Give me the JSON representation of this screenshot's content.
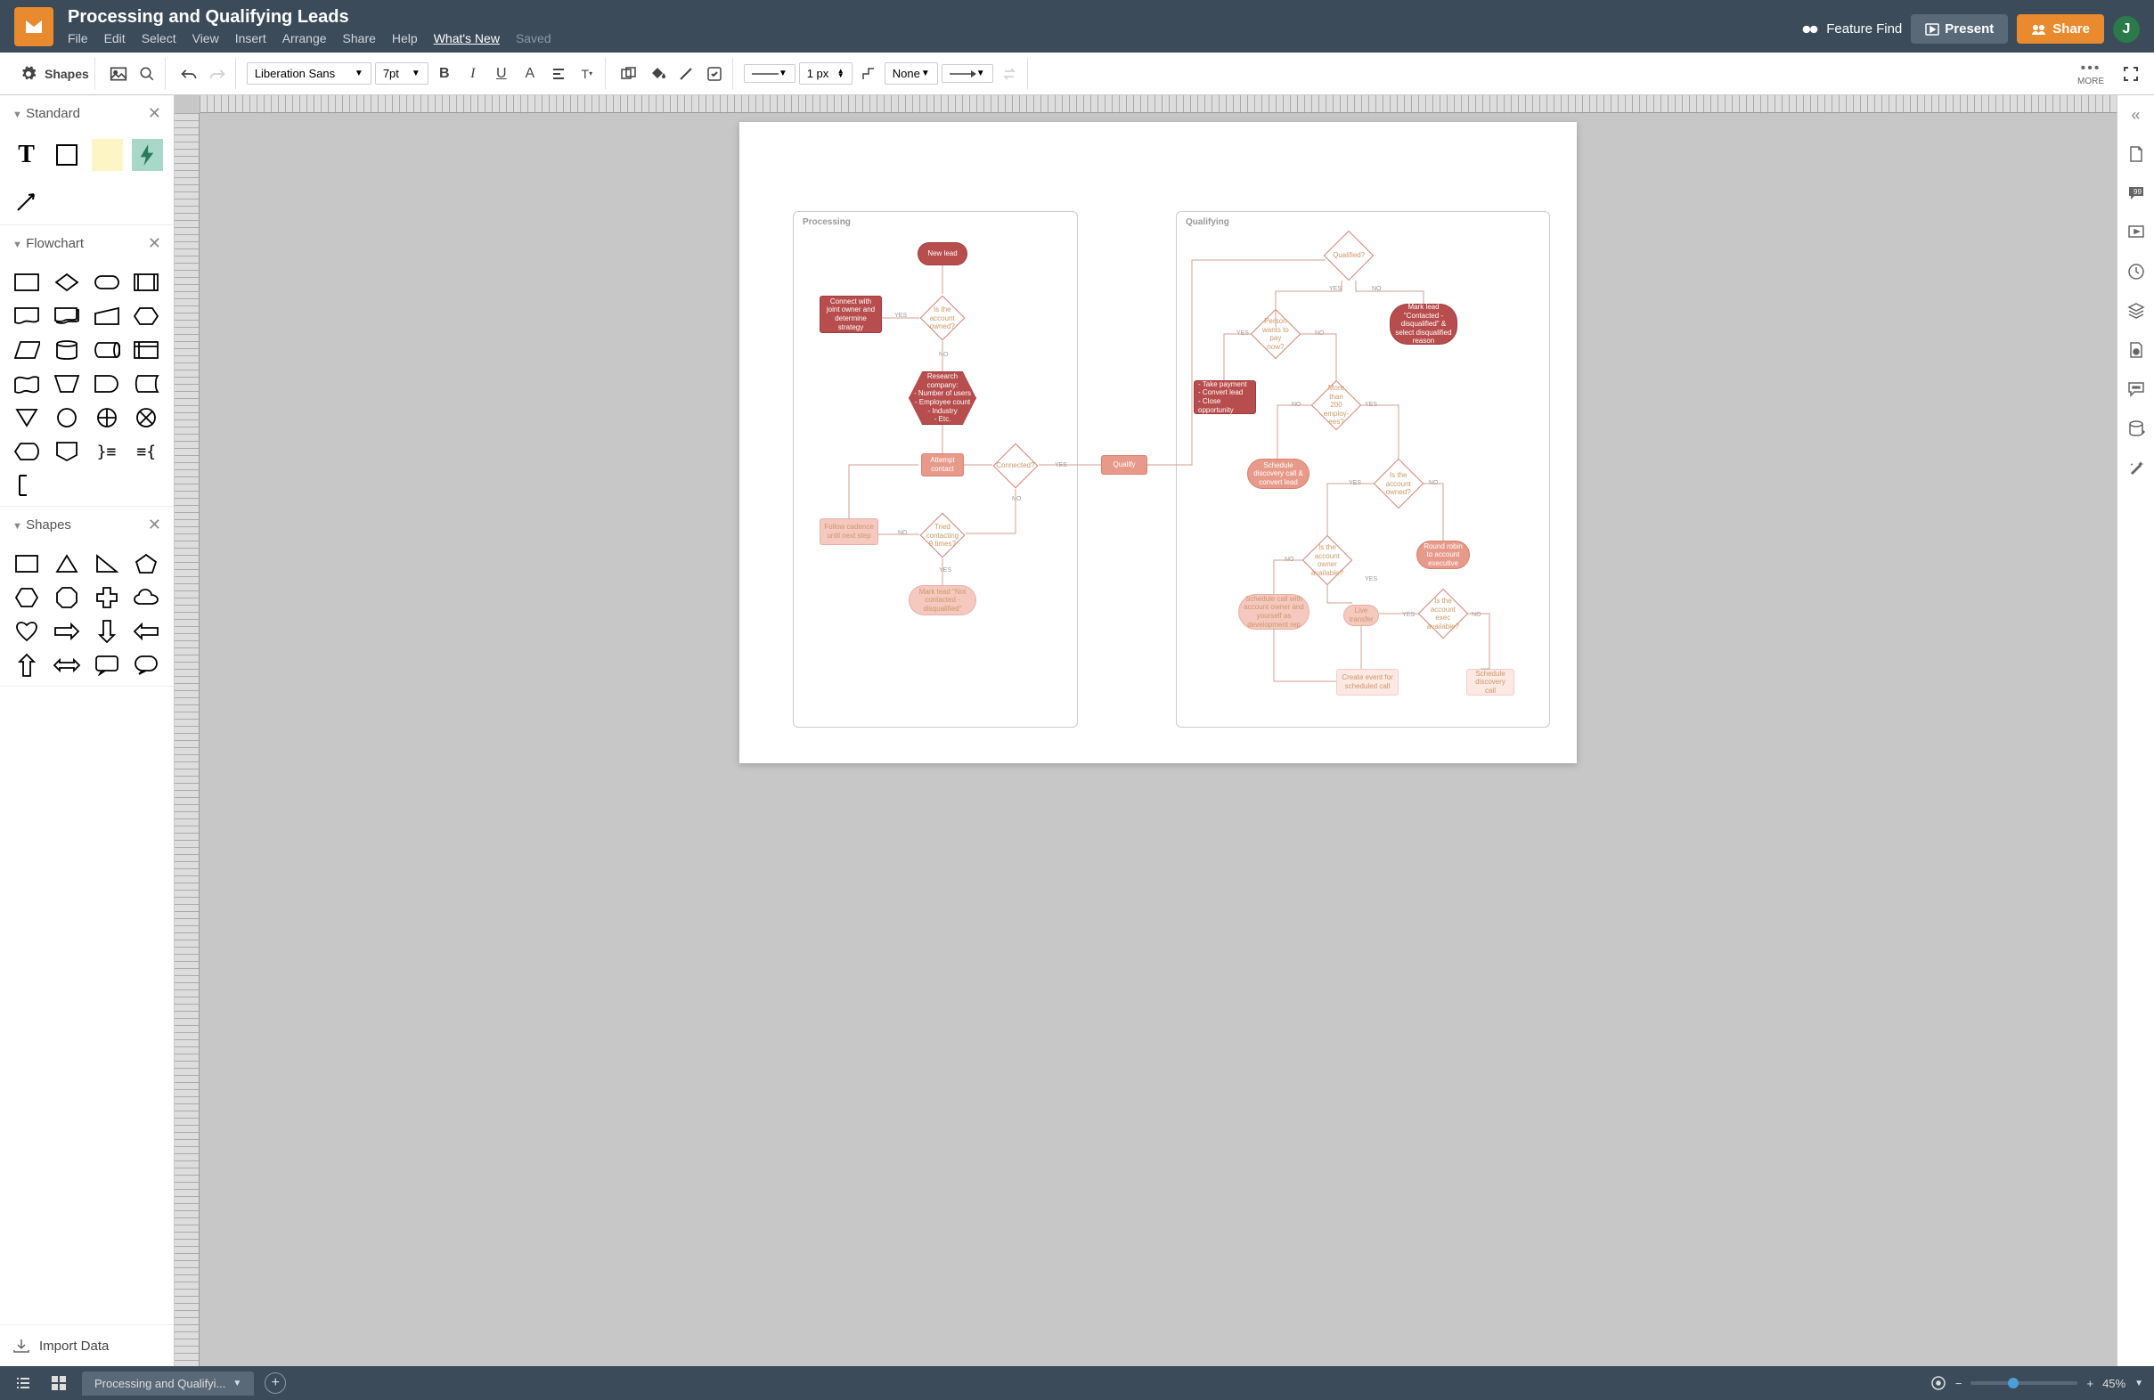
{
  "doc_title": "Processing and Qualifying Leads",
  "menu": {
    "file": "File",
    "edit": "Edit",
    "select": "Select",
    "view": "View",
    "insert": "Insert",
    "arrange": "Arrange",
    "share": "Share",
    "help": "Help",
    "whatsnew": "What's New",
    "saved": "Saved"
  },
  "header": {
    "feature_find": "Feature Find",
    "present": "Present",
    "share": "Share",
    "avatar": "J"
  },
  "toolbar": {
    "shapes": "Shapes",
    "font": "Liberation Sans",
    "font_size": "7pt",
    "line_width": "1 px",
    "line_style": "None",
    "more": "MORE"
  },
  "panels": {
    "standard": "Standard",
    "flowchart": "Flowchart",
    "shapes": "Shapes",
    "import": "Import Data"
  },
  "footer": {
    "tab": "Processing and Qualifyi...",
    "zoom": "45%"
  },
  "diagram": {
    "lanes": [
      {
        "id": "processing",
        "title": "Processing"
      },
      {
        "id": "qualifying",
        "title": "Qualifying"
      }
    ],
    "nodes": {
      "new_lead": "New lead",
      "account_owned": "Is the account owned?",
      "connect_owner": "Connect with joint owner and determine strategy",
      "research": "Research company:\n- Number of users\n- Employee count\n- Industry\n- Etc.",
      "attempt": "Attempt contact",
      "connected": "Connected?",
      "qualify": "Qualify",
      "tried9": "Tried contacting 9 times?",
      "cadence": "Follow cadence until next step",
      "not_contacted": "Mark lead \"Not contacted - disqualified\"",
      "qualified": "Qualified?",
      "pay_now": "Person wants to pay now?",
      "disqualified": "Mark lead \"Contacted - disqualified\" & select disqualified reason",
      "take_payment": "- Take payment\n- Convert lead\n- Close opportunity",
      "more200": "More than 200 employ-ees?",
      "schedule_discovery": "Schedule discovery call & convert lead",
      "account_owned2": "Is the account owned?",
      "owner_available": "Is the account owner available?",
      "round_robin": "Round robin to account executive",
      "exec_available": "Is the account exec available?",
      "live_transfer": "Live transfer",
      "schedule_owner": "Schedule call with account owner and yourself as development rep",
      "create_event": "Create event for scheduled call",
      "schedule_disc2": "Schedule discovery call"
    },
    "labels": {
      "yes": "YES",
      "no": "NO"
    }
  }
}
